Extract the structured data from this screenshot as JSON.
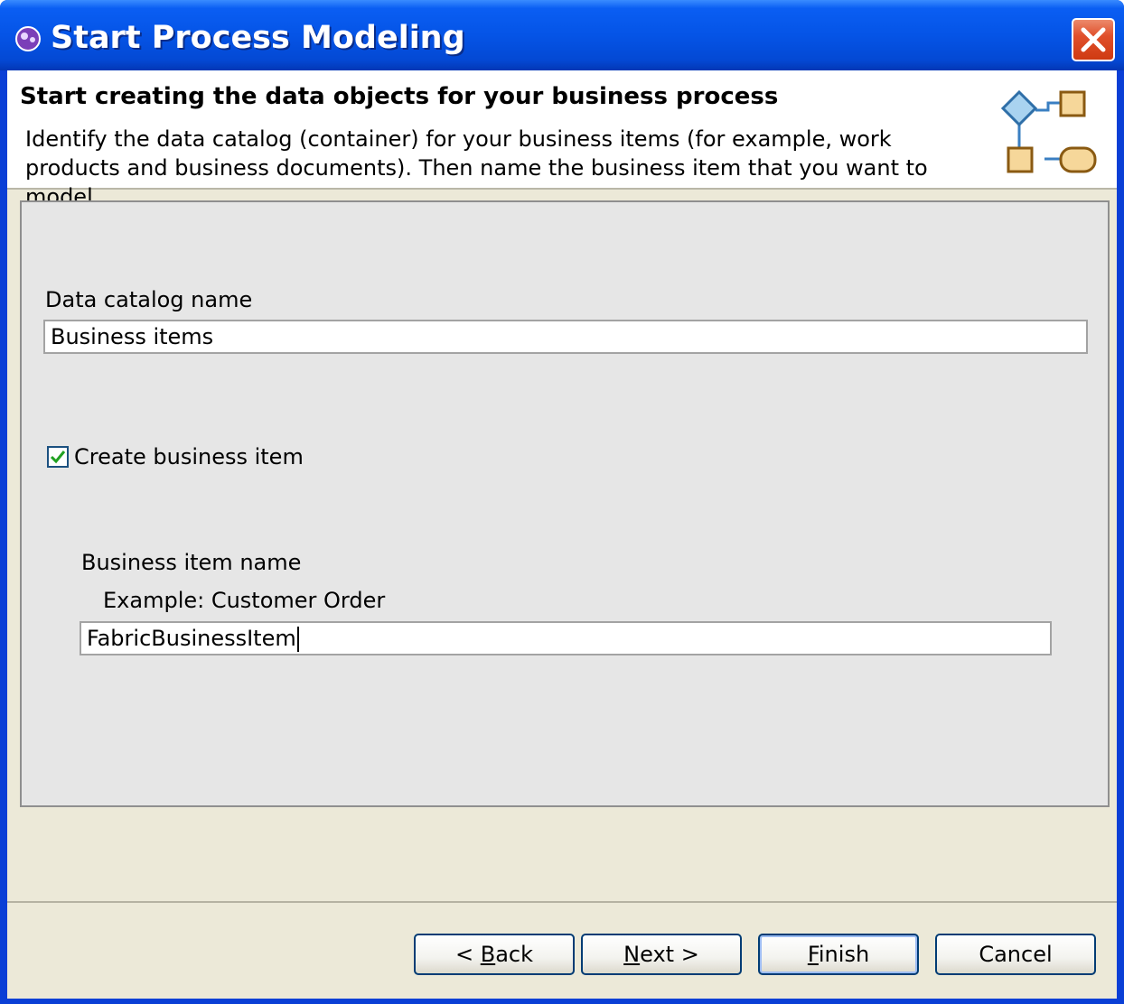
{
  "window": {
    "title": "Start Process Modeling"
  },
  "header": {
    "title": "Start creating the data objects for your business process",
    "description": "Identify the data catalog (container) for your business items (for example, work products and business documents). Then name the business item that you want to model."
  },
  "form": {
    "catalog_label": "Data catalog name",
    "catalog_value": "Business items",
    "create_item_label": "Create business item",
    "create_item_checked": true,
    "item_name_label": "Business item name",
    "item_example": "Example: Customer Order",
    "item_name_value": "FabricBusinessItem"
  },
  "buttons": {
    "back": {
      "prefix": "< ",
      "mnemonic": "B",
      "rest": "ack"
    },
    "next": {
      "prefix": "",
      "mnemonic": "N",
      "rest": "ext >"
    },
    "finish": {
      "prefix": "",
      "mnemonic": "F",
      "rest": "inish"
    },
    "cancel": {
      "label": "Cancel"
    }
  },
  "colors": {
    "title_bar": "#0554e6",
    "close_button": "#e0502c",
    "dialog_bg": "#ece9d8",
    "content_bg": "#e6e6e6",
    "check_mark": "#21a121"
  }
}
